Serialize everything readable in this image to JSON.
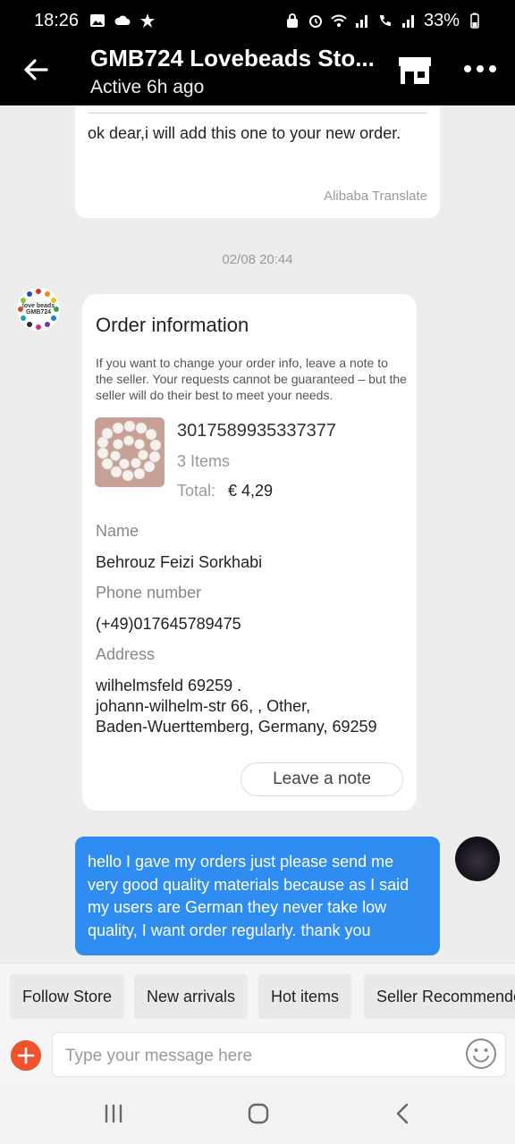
{
  "status_bar": {
    "time": "18:26",
    "battery": "33%"
  },
  "header": {
    "title": "GMB724 Lovebeads Sto...",
    "subtitle": "Active 6h ago"
  },
  "chat": {
    "seller_message": "ok dear,i will add this one to your new order.",
    "translate_label": "Alibaba Translate",
    "timestamp": "02/08 20:44",
    "store_avatar_text": "love beads GMB724",
    "order_card": {
      "title": "Order information",
      "description": "If you want to change your order info, leave a note to the seller. Your requests cannot be guaranteed – but the seller will do their best to meet your needs.",
      "order_id": "3017589935337377",
      "items": "3 Items",
      "total_label": "Total:",
      "total_value": "€ 4,29",
      "name_label": "Name",
      "name_value": "Behrouz Feizi Sorkhabi",
      "phone_label": "Phone number",
      "phone_value": "(+49)017645789475",
      "address_label": "Address",
      "address_line1": "wilhelmsfeld 69259 .",
      "address_line2": "johann-wilhelm-str 66, , Other,",
      "address_line3": "Baden-Wuerttemberg, Germany, 69259",
      "leave_note_label": "Leave a note"
    },
    "user_message": "hello I gave my orders just please send me very good quality materials because as I said my users are German they never take low quality, I want order regularly. thank you"
  },
  "quick_replies": [
    "Follow Store",
    "New arrivals",
    "Hot items",
    "Seller Recommende"
  ],
  "composer": {
    "placeholder": "Type your message here"
  },
  "colors": {
    "accent_blue": "#2f8cf0",
    "plus_orange": "#f0522e"
  }
}
